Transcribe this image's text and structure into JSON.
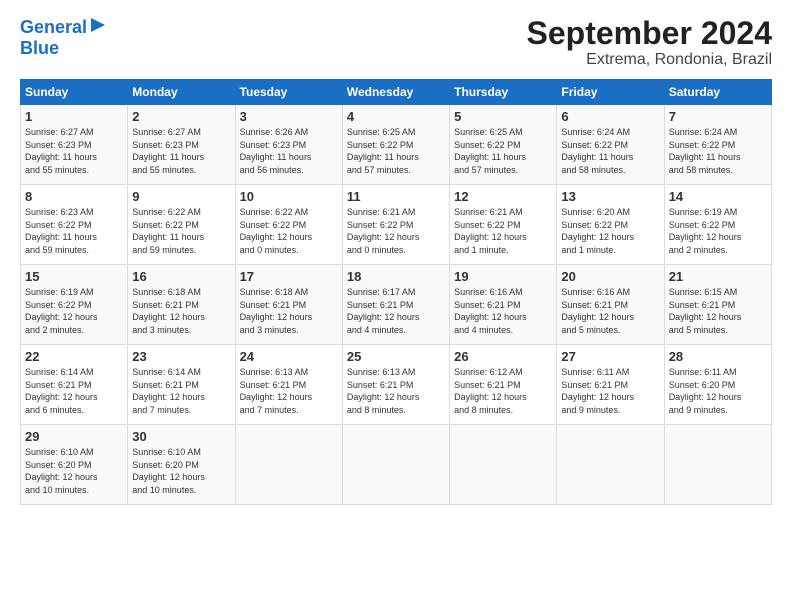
{
  "logo": {
    "line1": "General",
    "line2": "Blue"
  },
  "title": "September 2024",
  "subtitle": "Extrema, Rondonia, Brazil",
  "days_header": [
    "Sunday",
    "Monday",
    "Tuesday",
    "Wednesday",
    "Thursday",
    "Friday",
    "Saturday"
  ],
  "weeks": [
    [
      {
        "day": "1",
        "info": "Sunrise: 6:27 AM\nSunset: 6:23 PM\nDaylight: 11 hours\nand 55 minutes."
      },
      {
        "day": "2",
        "info": "Sunrise: 6:27 AM\nSunset: 6:23 PM\nDaylight: 11 hours\nand 55 minutes."
      },
      {
        "day": "3",
        "info": "Sunrise: 6:26 AM\nSunset: 6:23 PM\nDaylight: 11 hours\nand 56 minutes."
      },
      {
        "day": "4",
        "info": "Sunrise: 6:25 AM\nSunset: 6:22 PM\nDaylight: 11 hours\nand 57 minutes."
      },
      {
        "day": "5",
        "info": "Sunrise: 6:25 AM\nSunset: 6:22 PM\nDaylight: 11 hours\nand 57 minutes."
      },
      {
        "day": "6",
        "info": "Sunrise: 6:24 AM\nSunset: 6:22 PM\nDaylight: 11 hours\nand 58 minutes."
      },
      {
        "day": "7",
        "info": "Sunrise: 6:24 AM\nSunset: 6:22 PM\nDaylight: 11 hours\nand 58 minutes."
      }
    ],
    [
      {
        "day": "8",
        "info": "Sunrise: 6:23 AM\nSunset: 6:22 PM\nDaylight: 11 hours\nand 59 minutes."
      },
      {
        "day": "9",
        "info": "Sunrise: 6:22 AM\nSunset: 6:22 PM\nDaylight: 11 hours\nand 59 minutes."
      },
      {
        "day": "10",
        "info": "Sunrise: 6:22 AM\nSunset: 6:22 PM\nDaylight: 12 hours\nand 0 minutes."
      },
      {
        "day": "11",
        "info": "Sunrise: 6:21 AM\nSunset: 6:22 PM\nDaylight: 12 hours\nand 0 minutes."
      },
      {
        "day": "12",
        "info": "Sunrise: 6:21 AM\nSunset: 6:22 PM\nDaylight: 12 hours\nand 1 minute."
      },
      {
        "day": "13",
        "info": "Sunrise: 6:20 AM\nSunset: 6:22 PM\nDaylight: 12 hours\nand 1 minute."
      },
      {
        "day": "14",
        "info": "Sunrise: 6:19 AM\nSunset: 6:22 PM\nDaylight: 12 hours\nand 2 minutes."
      }
    ],
    [
      {
        "day": "15",
        "info": "Sunrise: 6:19 AM\nSunset: 6:22 PM\nDaylight: 12 hours\nand 2 minutes."
      },
      {
        "day": "16",
        "info": "Sunrise: 6:18 AM\nSunset: 6:21 PM\nDaylight: 12 hours\nand 3 minutes."
      },
      {
        "day": "17",
        "info": "Sunrise: 6:18 AM\nSunset: 6:21 PM\nDaylight: 12 hours\nand 3 minutes."
      },
      {
        "day": "18",
        "info": "Sunrise: 6:17 AM\nSunset: 6:21 PM\nDaylight: 12 hours\nand 4 minutes."
      },
      {
        "day": "19",
        "info": "Sunrise: 6:16 AM\nSunset: 6:21 PM\nDaylight: 12 hours\nand 4 minutes."
      },
      {
        "day": "20",
        "info": "Sunrise: 6:16 AM\nSunset: 6:21 PM\nDaylight: 12 hours\nand 5 minutes."
      },
      {
        "day": "21",
        "info": "Sunrise: 6:15 AM\nSunset: 6:21 PM\nDaylight: 12 hours\nand 5 minutes."
      }
    ],
    [
      {
        "day": "22",
        "info": "Sunrise: 6:14 AM\nSunset: 6:21 PM\nDaylight: 12 hours\nand 6 minutes."
      },
      {
        "day": "23",
        "info": "Sunrise: 6:14 AM\nSunset: 6:21 PM\nDaylight: 12 hours\nand 7 minutes."
      },
      {
        "day": "24",
        "info": "Sunrise: 6:13 AM\nSunset: 6:21 PM\nDaylight: 12 hours\nand 7 minutes."
      },
      {
        "day": "25",
        "info": "Sunrise: 6:13 AM\nSunset: 6:21 PM\nDaylight: 12 hours\nand 8 minutes."
      },
      {
        "day": "26",
        "info": "Sunrise: 6:12 AM\nSunset: 6:21 PM\nDaylight: 12 hours\nand 8 minutes."
      },
      {
        "day": "27",
        "info": "Sunrise: 6:11 AM\nSunset: 6:21 PM\nDaylight: 12 hours\nand 9 minutes."
      },
      {
        "day": "28",
        "info": "Sunrise: 6:11 AM\nSunset: 6:20 PM\nDaylight: 12 hours\nand 9 minutes."
      }
    ],
    [
      {
        "day": "29",
        "info": "Sunrise: 6:10 AM\nSunset: 6:20 PM\nDaylight: 12 hours\nand 10 minutes."
      },
      {
        "day": "30",
        "info": "Sunrise: 6:10 AM\nSunset: 6:20 PM\nDaylight: 12 hours\nand 10 minutes."
      },
      {
        "day": "",
        "info": ""
      },
      {
        "day": "",
        "info": ""
      },
      {
        "day": "",
        "info": ""
      },
      {
        "day": "",
        "info": ""
      },
      {
        "day": "",
        "info": ""
      }
    ]
  ]
}
